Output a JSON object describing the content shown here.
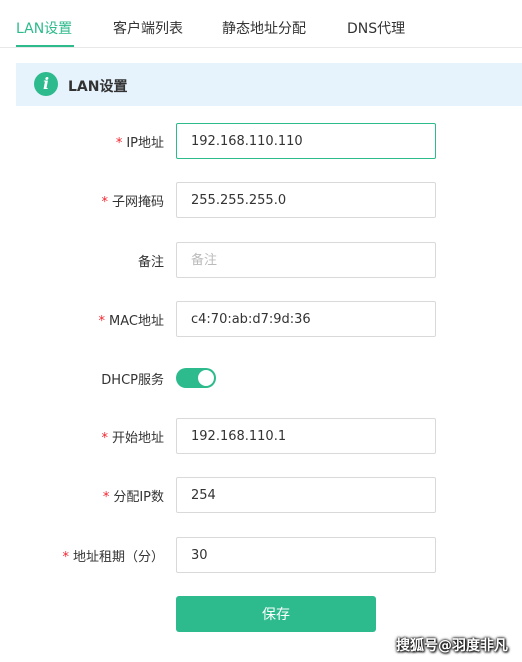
{
  "tabs": [
    {
      "label": "LAN设置",
      "active": true
    },
    {
      "label": "客户端列表",
      "active": false
    },
    {
      "label": "静态地址分配",
      "active": false
    },
    {
      "label": "DNS代理",
      "active": false
    }
  ],
  "banner": {
    "icon": "info-icon",
    "icon_glyph": "i",
    "title": "LAN设置"
  },
  "form": {
    "required_mark": "*",
    "ip": {
      "label": "IP地址",
      "value": "192.168.110.110"
    },
    "subnet": {
      "label": "子网掩码",
      "value": "255.255.255.0"
    },
    "remark": {
      "label": "备注",
      "value": "",
      "placeholder": "备注"
    },
    "mac": {
      "label": "MAC地址",
      "value": "c4:70:ab:d7:9d:36"
    },
    "dhcp": {
      "label": "DHCP服务",
      "enabled": true
    },
    "start": {
      "label": "开始地址",
      "value": "192.168.110.1"
    },
    "count": {
      "label": "分配IP数",
      "value": "254"
    },
    "lease": {
      "label": "地址租期（分）",
      "value": "30"
    }
  },
  "save_label": "保存",
  "watermark": "搜狐号@羽度非凡",
  "colors": {
    "accent": "#2dba8c",
    "required": "#f5222d",
    "banner_bg": "#e6f3fc"
  }
}
